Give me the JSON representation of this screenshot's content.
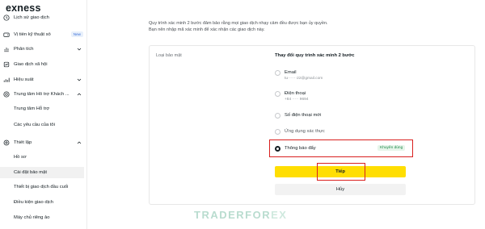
{
  "brand": {
    "logo_text": "exness"
  },
  "sidebar": {
    "items": [
      {
        "label": "Lịch sử giao dịch",
        "icon": "history-icon"
      },
      {
        "label": "Vị tiền kỹ thuật số",
        "icon": "wallet-icon",
        "badge": "New"
      },
      {
        "label": "Phân tích",
        "icon": "chart-icon"
      },
      {
        "label": "Giao dịch xã hội",
        "icon": "social-icon"
      },
      {
        "label": "Hiệu suất",
        "icon": "performance-icon"
      },
      {
        "label": "Trung tâm Hỗ trợ Khách ...",
        "icon": "support-icon"
      },
      {
        "label": "Thiết lập",
        "icon": "settings-icon"
      }
    ],
    "support_sub": [
      "Trung tâm Hỗ trợ",
      "Các yêu cầu của tôi"
    ],
    "settings_sub": [
      "Hồ sơ",
      "Cài đặt bảo mật",
      "Thiết bị giao dịch đầu cuối",
      "Điều kiện giao dịch",
      "Máy chủ riêng ảo"
    ]
  },
  "main": {
    "intro_line1": "Quy trình xác minh 2 bước đảm bảo rằng mọi giao dịch nhạy cảm đều được bạn ủy quyền.",
    "intro_line2": "Bạn nên nhập mã xác minh để xác nhận các giao dịch này.",
    "left_label": "Loại bảo mật",
    "title": "Thay đổi quy trình xác minh 2 bước",
    "options": [
      {
        "title": "Email",
        "sub": "tu·······22@gmail.com",
        "checked": false
      },
      {
        "title": "Điện thoại",
        "sub": "+84 ····· 9694",
        "checked": false
      },
      {
        "title": "Số điện thoại mới",
        "checked": false
      },
      {
        "title": "Ứng dụng xác thực",
        "checked": false
      },
      {
        "title": "Thông báo đẩy",
        "checked": true,
        "tag": "Khuyên dùng"
      }
    ],
    "continue_label": "Tiếp",
    "cancel_label": "Hủy"
  },
  "watermark": {
    "main": "TRADERFOR",
    "tail": "EX"
  },
  "colors": {
    "accent_yellow": "#ffde02",
    "highlight_red": "#d9201f",
    "recommended_green": "#1f8a4a"
  }
}
